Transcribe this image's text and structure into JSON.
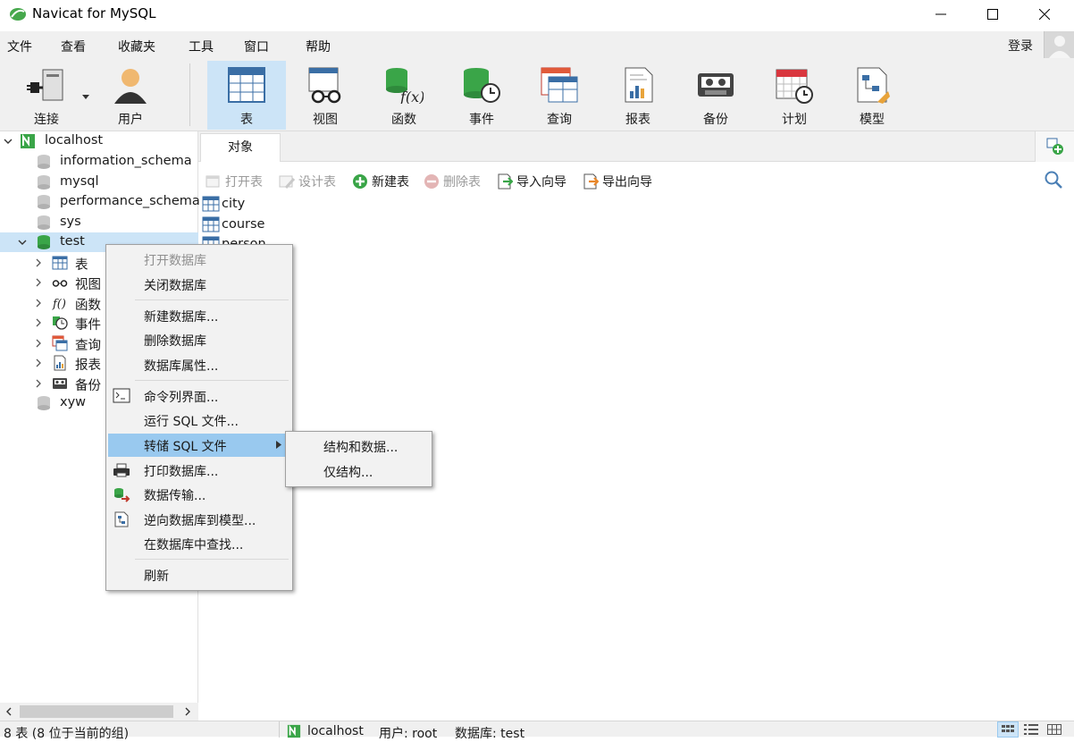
{
  "window": {
    "title": "Navicat for MySQL"
  },
  "menubar": {
    "items": [
      "文件",
      "查看",
      "收藏夹",
      "工具",
      "窗口",
      "帮助"
    ],
    "login": "登录"
  },
  "toolbar": {
    "items": [
      {
        "label": "连接",
        "icon": "connection-icon"
      },
      {
        "label": "用户",
        "icon": "user-icon"
      },
      {
        "label": "表",
        "icon": "table-icon"
      },
      {
        "label": "视图",
        "icon": "view-icon"
      },
      {
        "label": "函数",
        "icon": "function-icon"
      },
      {
        "label": "事件",
        "icon": "event-icon"
      },
      {
        "label": "查询",
        "icon": "query-icon"
      },
      {
        "label": "报表",
        "icon": "report-icon"
      },
      {
        "label": "备份",
        "icon": "backup-icon"
      },
      {
        "label": "计划",
        "icon": "schedule-icon"
      },
      {
        "label": "模型",
        "icon": "model-icon"
      }
    ],
    "active_index": 2
  },
  "sidebar": {
    "connection": "localhost",
    "databases": [
      "information_schema",
      "mysql",
      "performance_schema",
      "sys",
      "test",
      "xyw"
    ],
    "test_children": [
      "表",
      "视图",
      "函数",
      "事件",
      "查询",
      "报表",
      "备份"
    ]
  },
  "objects": {
    "tab": "对象",
    "actions": [
      {
        "label": "打开表",
        "enabled": false
      },
      {
        "label": "设计表",
        "enabled": false
      },
      {
        "label": "新建表",
        "enabled": true
      },
      {
        "label": "删除表",
        "enabled": false
      },
      {
        "label": "导入向导",
        "enabled": true
      },
      {
        "label": "导出向导",
        "enabled": true
      }
    ],
    "tables": [
      "city",
      "course",
      "person"
    ]
  },
  "context_menu": {
    "items": [
      {
        "label": "打开数据库",
        "enabled": false
      },
      {
        "label": "关闭数据库",
        "enabled": true
      },
      {
        "label": "新建数据库...",
        "enabled": true
      },
      {
        "label": "删除数据库",
        "enabled": true
      },
      {
        "label": "数据库属性...",
        "enabled": true
      },
      {
        "label": "命令列界面...",
        "enabled": true,
        "icon": "console-icon"
      },
      {
        "label": "运行 SQL 文件...",
        "enabled": true
      },
      {
        "label": "转储 SQL 文件",
        "enabled": true,
        "highlighted": true
      },
      {
        "label": "打印数据库...",
        "enabled": true,
        "icon": "printer-icon"
      },
      {
        "label": "数据传输...",
        "enabled": true,
        "icon": "data-transfer-icon"
      },
      {
        "label": "逆向数据库到模型...",
        "enabled": true,
        "icon": "reverse-model-icon"
      },
      {
        "label": "在数据库中查找...",
        "enabled": true
      },
      {
        "label": "刷新",
        "enabled": true
      }
    ],
    "submenu": [
      "结构和数据...",
      "仅结构..."
    ]
  },
  "statusbar": {
    "left": "8 表 (8 位于当前的组)",
    "connection": "localhost",
    "user": "用户: root",
    "database": "数据库: test"
  },
  "colors": {
    "accent": "#cce4f7",
    "menu_highlight": "#99c9ef",
    "navicat_green": "#3aa548"
  }
}
